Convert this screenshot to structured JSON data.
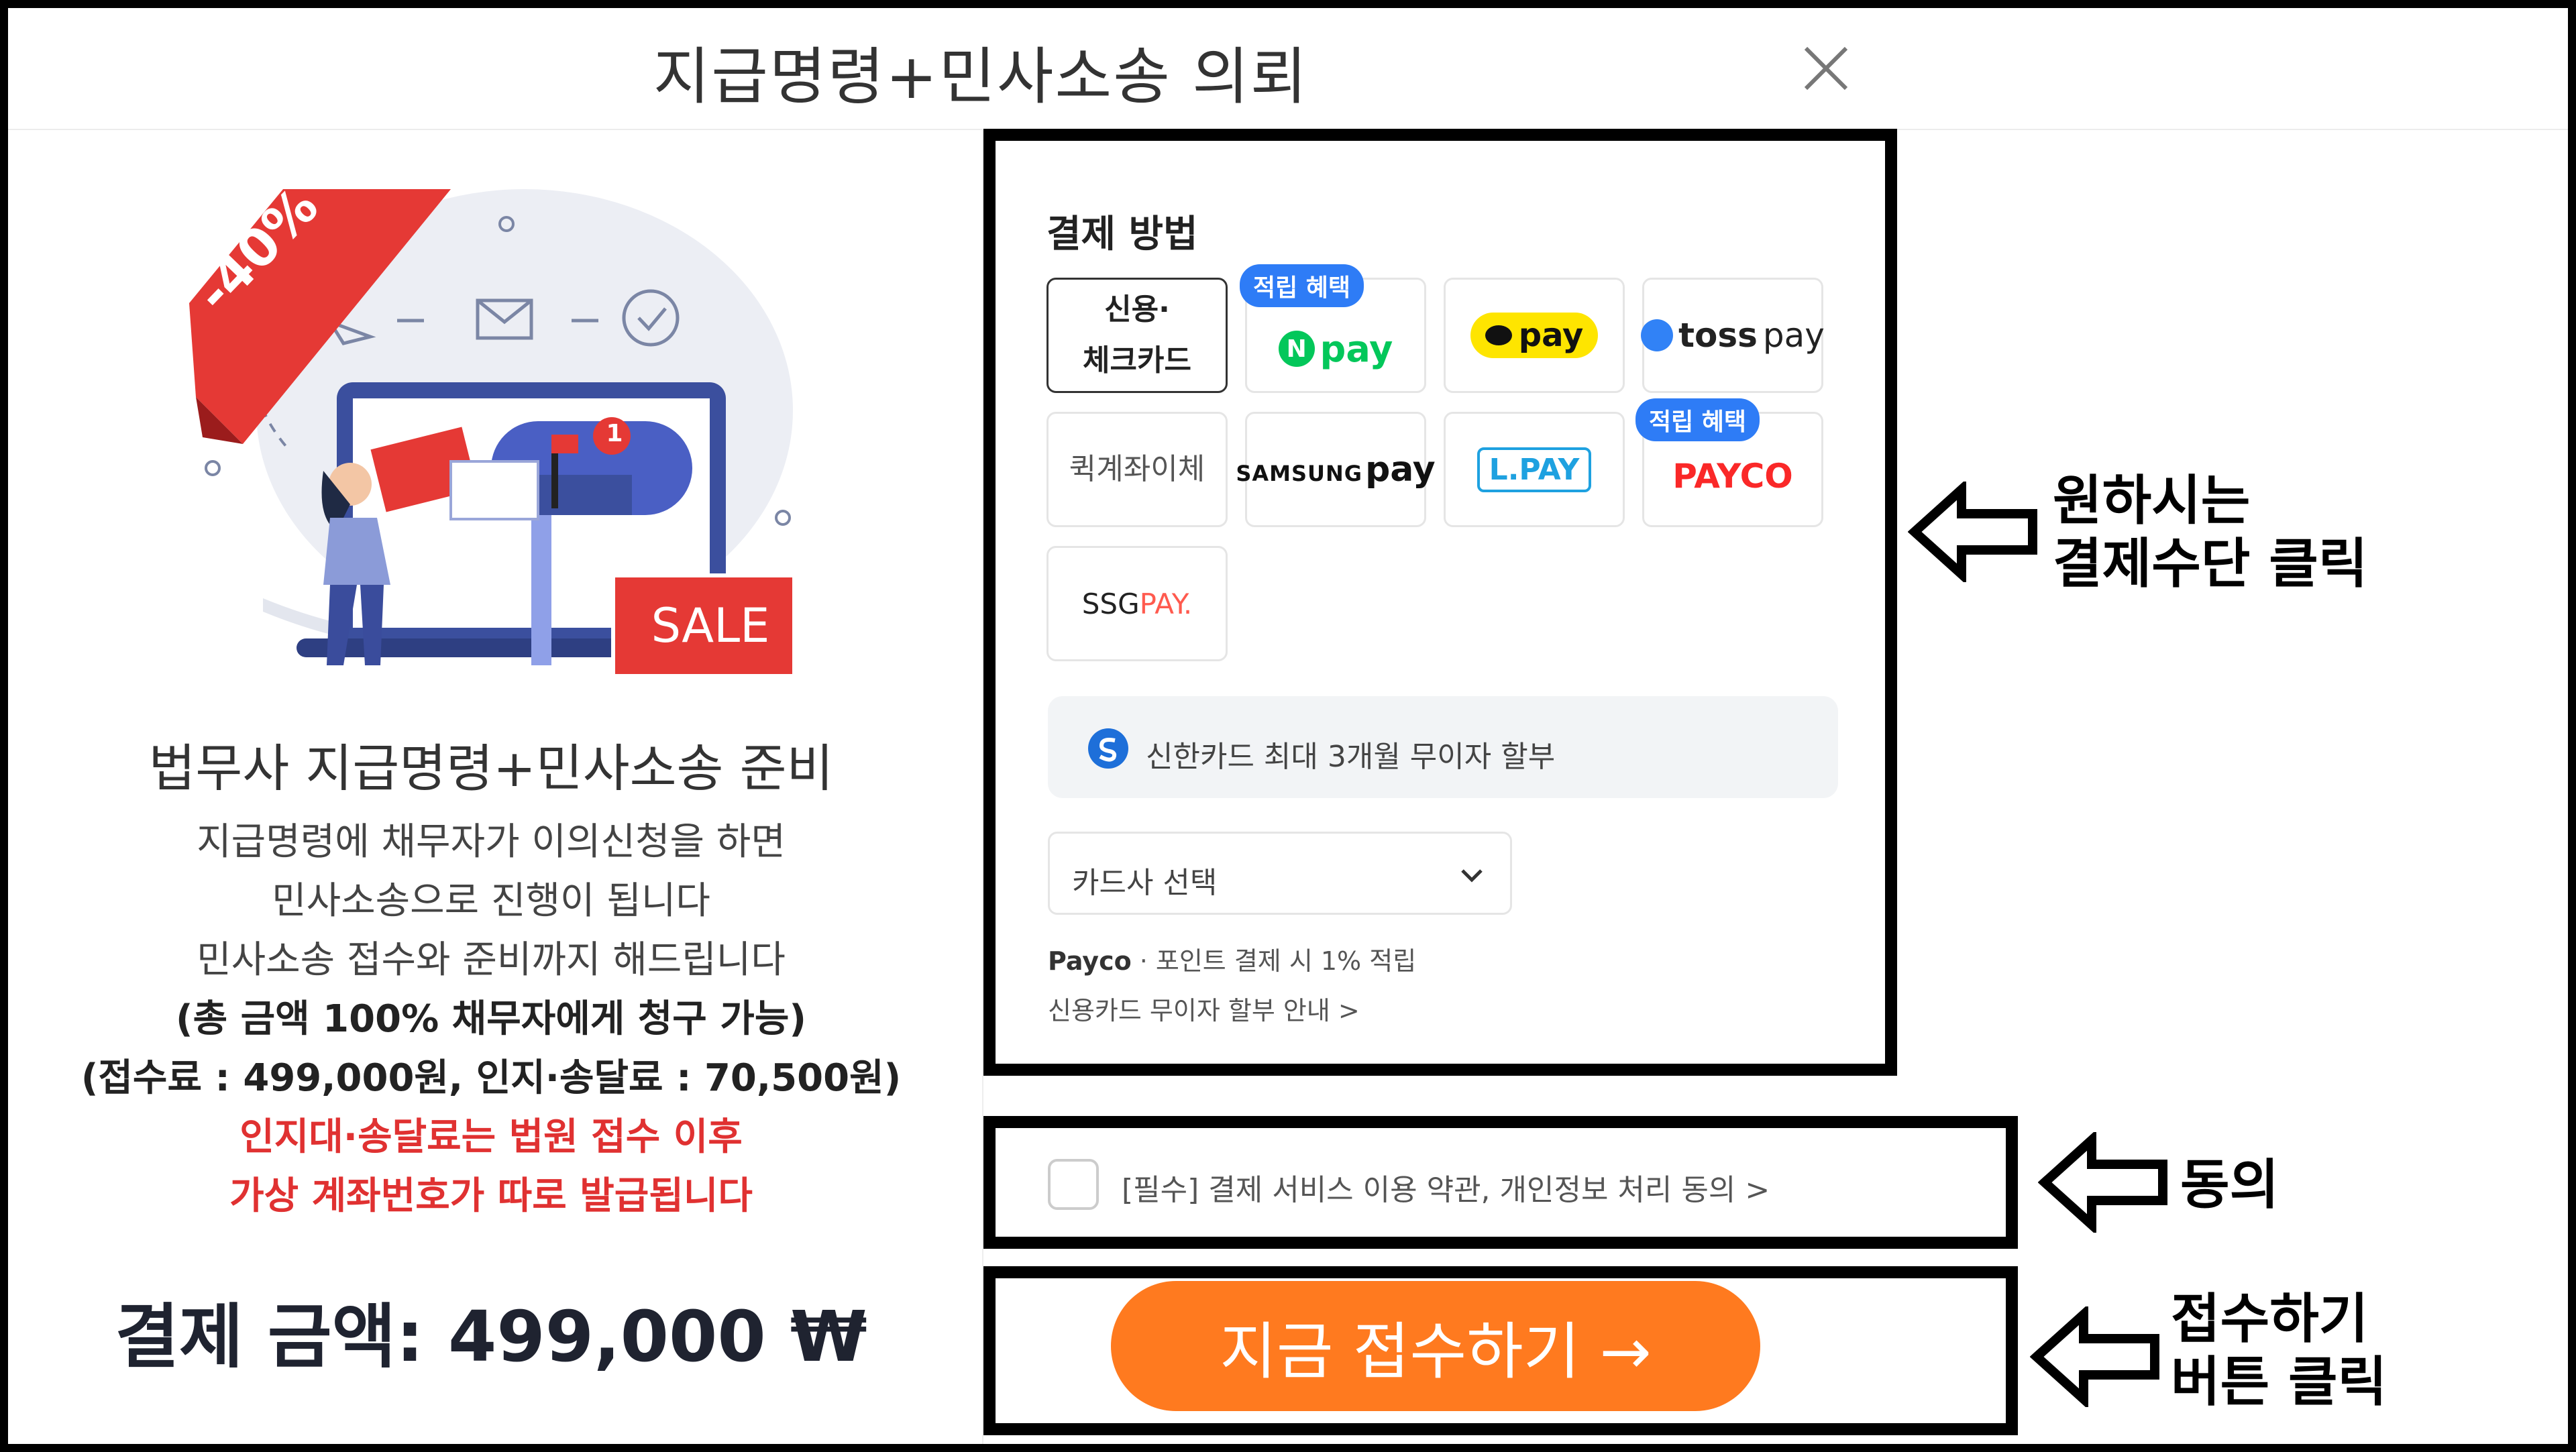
{
  "header": {
    "title": "지급명령+민사소송 의뢰"
  },
  "promo": {
    "discount": "-40%",
    "sale": "SALE",
    "notification_count": "1"
  },
  "service": {
    "heading": "법무사 지급명령+민사소송 준비",
    "lines": [
      "지급명령에 채무자가 이의신청을 하면",
      "민사소송으로 진행이 됩니다",
      "민사소송 접수와 준비까지 해드립니다"
    ],
    "bold_lines": [
      "(총 금액 100% 채무자에게 청구 가능)",
      "(접수료 : 499,000원, 인지·송달료 : 70,500원)"
    ],
    "red_lines": [
      "인지대·송달료는 법원 접수 이후",
      "가상 계좌번호가 따로 발급됩니다"
    ],
    "amount": "결제 금액: 499,000 ₩"
  },
  "payment": {
    "title": "결제 방법",
    "methods": [
      {
        "line1": "신용·",
        "line2": "체크카드"
      },
      {
        "badge": "적립 혜택",
        "logo": "pay",
        "icon": "N"
      },
      {
        "logo": "pay"
      },
      {
        "logo_a": "toss",
        "logo_b": "pay"
      },
      {
        "label": "퀵계좌이체"
      },
      {
        "logo_a": "SAMSUNG",
        "logo_b": "pay"
      },
      {
        "logo": "L.PAY"
      },
      {
        "badge": "적립 혜택",
        "logo": "PAYCO"
      },
      {
        "logo_a": "SSG",
        "logo_b": "PAY."
      }
    ],
    "notice": "신한카드 최대 3개월 무이자 할부",
    "card_select": "카드사 선택",
    "payco_label": "Payco",
    "payco_note": "· 포인트 결제 시 1% 적립",
    "installment_link": "신용카드 무이자 할부 안내 >"
  },
  "agree": {
    "text": "[필수] 결제 서비스 이용 약관, 개인정보 처리 동의 >"
  },
  "submit": {
    "label": "지금 접수하기 →"
  },
  "annotations": {
    "payment_note": [
      "원하시는",
      "결제수단 클릭"
    ],
    "agree_note": "동의",
    "submit_note": [
      "접수하기",
      "버튼 클릭"
    ]
  },
  "colors": {
    "accent": "#ff7a1f",
    "badge": "#2e7cf6",
    "red": "#e03131",
    "naver": "#03c75a",
    "kakao": "#fee500",
    "payco": "#fa2828",
    "toss": "#3182f6"
  }
}
